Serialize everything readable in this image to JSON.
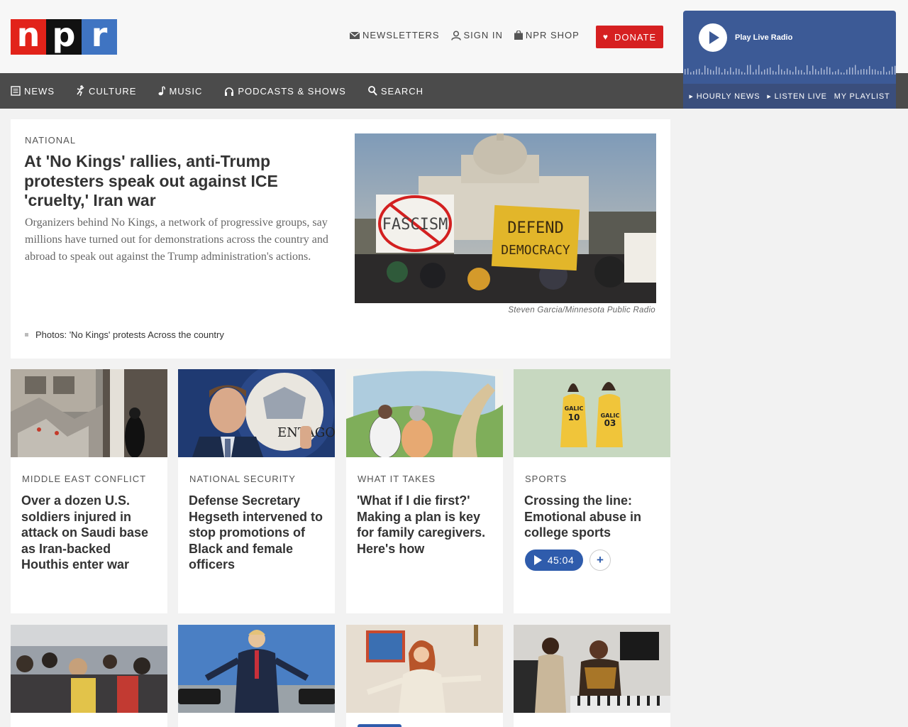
{
  "logo": {
    "letters": [
      "n",
      "p",
      "r"
    ]
  },
  "util_nav": {
    "newsletters": "NEWSLETTERS",
    "sign_in": "SIGN IN",
    "shop": "NPR SHOP",
    "donate": "DONATE"
  },
  "player": {
    "label": "Play Live Radio",
    "links": [
      "HOURLY NEWS",
      "LISTEN LIVE",
      "MY PLAYLIST"
    ]
  },
  "main_nav": {
    "items": [
      {
        "label": "NEWS",
        "icon": "news-icon"
      },
      {
        "label": "CULTURE",
        "icon": "culture-icon"
      },
      {
        "label": "MUSIC",
        "icon": "music-note-icon"
      },
      {
        "label": "PODCASTS & SHOWS",
        "icon": "headphones-icon"
      },
      {
        "label": "SEARCH",
        "icon": "search-icon"
      }
    ]
  },
  "lead": {
    "slug": "NATIONAL",
    "title": "At 'No Kings' rallies, anti-Trump protesters speak out against ICE 'cruelty,' Iran war",
    "teaser": "Organizers behind No Kings, a network of progressive groups, say millions have turned out for demonstrations across the country and abroad to speak out against the Trump administration's actions.",
    "credit": "Steven Garcia/Minnesota Public Radio",
    "related": "Photos: 'No Kings' protests Across the country",
    "photo_signs": {
      "left": "FASCISM",
      "right_1": "DEFEND",
      "right_2": "DEMOCRACY"
    }
  },
  "cards": [
    {
      "slug": "MIDDLE EAST CONFLICT",
      "title": "Over a dozen U.S. soldiers injured in attack on Saudi base as Iran-backed Houthis enter war"
    },
    {
      "slug": "NATIONAL SECURITY",
      "title": "Defense Secretary Hegseth intervened to stop promotions of Black and female officers",
      "photo_text": "ENTAGON"
    },
    {
      "slug": "WHAT IT TAKES",
      "title": "'What if I die first?' Making a plan is key for family caregivers. Here's how"
    },
    {
      "slug": "SPORTS",
      "title": "Crossing the line: Emotional abuse in college sports",
      "audio_duration": "45:04",
      "jerseys": [
        {
          "name": "GALIC",
          "num": "10"
        },
        {
          "name": "GALIC",
          "num": "03"
        }
      ]
    }
  ],
  "colors": {
    "red": "#d62021",
    "player_blue": "#3c5a96",
    "nav_gray": "#4b4b4b",
    "audio_blue": "#2f5cac"
  }
}
